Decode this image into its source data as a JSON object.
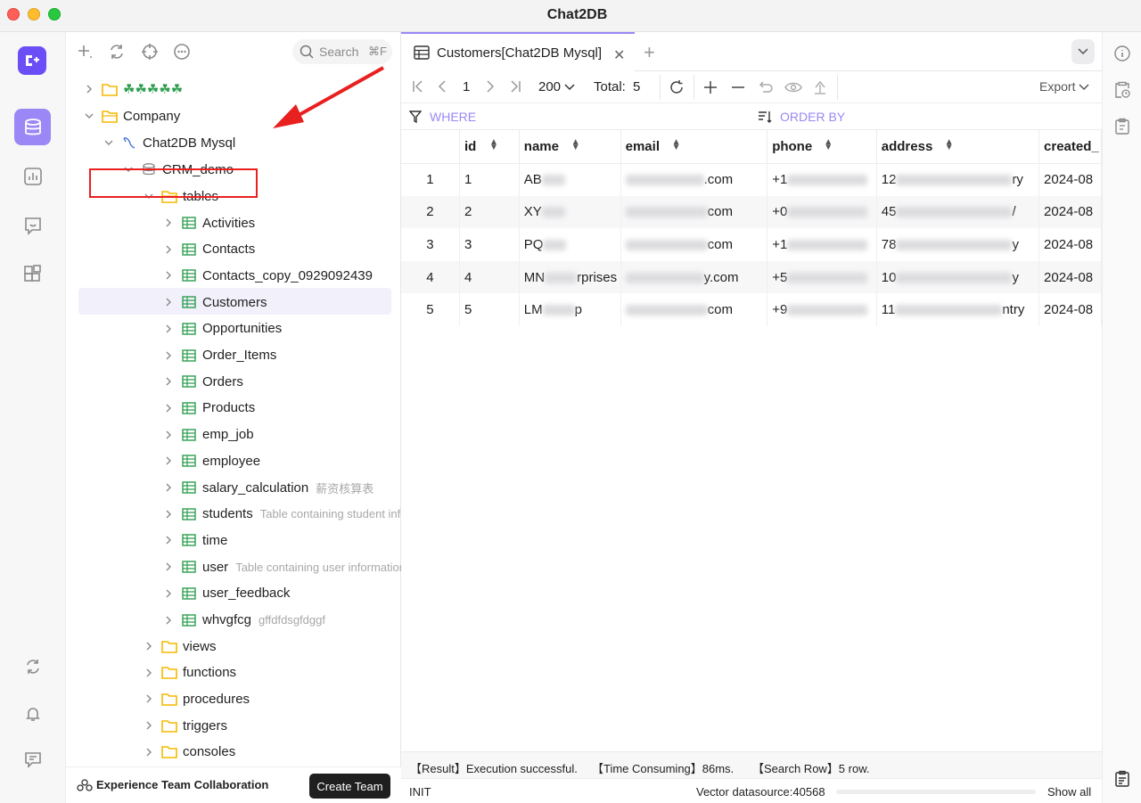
{
  "window": {
    "title": "Chat2DB"
  },
  "activity": {
    "items": [
      {
        "icon": "database-icon",
        "active": true
      },
      {
        "icon": "chart-icon",
        "active": false
      },
      {
        "icon": "chat-icon",
        "active": false
      },
      {
        "icon": "apps-icon",
        "active": false
      }
    ],
    "bottom": [
      "sync-icon",
      "bell-icon",
      "message-icon"
    ]
  },
  "sidebar": {
    "search_placeholder": "Search",
    "search_shortcut": "⌘F",
    "footer_label": "Experience Team Collaboration",
    "create_team_label": "Create Team",
    "tree": {
      "group1": "☘☘☘☘☘",
      "company": "Company",
      "connection": "Chat2DB Mysql",
      "database": "CRM_demo",
      "tables_folder": "tables",
      "tables": [
        {
          "name": "Activities",
          "comment": ""
        },
        {
          "name": "Contacts",
          "comment": ""
        },
        {
          "name": "Contacts_copy_0929092439",
          "comment": ""
        },
        {
          "name": "Customers",
          "comment": ""
        },
        {
          "name": "Opportunities",
          "comment": ""
        },
        {
          "name": "Order_Items",
          "comment": ""
        },
        {
          "name": "Orders",
          "comment": ""
        },
        {
          "name": "Products",
          "comment": ""
        },
        {
          "name": "emp_job",
          "comment": ""
        },
        {
          "name": "employee",
          "comment": ""
        },
        {
          "name": "salary_calculation",
          "comment": "薪资核算表"
        },
        {
          "name": "students",
          "comment": "Table containing student info"
        },
        {
          "name": "time",
          "comment": ""
        },
        {
          "name": "user",
          "comment": "Table containing user information"
        },
        {
          "name": "user_feedback",
          "comment": ""
        },
        {
          "name": "whvgfcg",
          "comment": "gffdfdsgfdggf"
        }
      ],
      "folders": [
        "views",
        "functions",
        "procedures",
        "triggers",
        "consoles"
      ]
    }
  },
  "main": {
    "tab": {
      "label": "Customers[Chat2DB Mysql]"
    },
    "pager": {
      "page": "1",
      "page_size": "200",
      "total_label": "Total:",
      "total": "5",
      "export_label": "Export"
    },
    "filters": {
      "where": "WHERE",
      "order_by": "ORDER BY"
    },
    "grid": {
      "columns": [
        "id",
        "name",
        "email",
        "phone",
        "address",
        "created_"
      ],
      "rows": [
        {
          "rn": "1",
          "id": "1",
          "name_pre": "AB",
          "name_post": "",
          "email_post": ".com",
          "phone_pre": "+1",
          "addr_pre": "12",
          "addr_post": "ry",
          "created": "2024-08"
        },
        {
          "rn": "2",
          "id": "2",
          "name_pre": "XY",
          "name_post": "",
          "email_post": "com",
          "phone_pre": "+0",
          "addr_pre": "45",
          "addr_post": "/",
          "created": "2024-08"
        },
        {
          "rn": "3",
          "id": "3",
          "name_pre": "PQ",
          "name_post": "",
          "email_post": "com",
          "phone_pre": "+1",
          "addr_pre": "78",
          "addr_post": "y",
          "created": "2024-08"
        },
        {
          "rn": "4",
          "id": "4",
          "name_pre": "MN",
          "name_post": "rprises",
          "email_post": "y.com",
          "phone_pre": "+5",
          "addr_pre": "10",
          "addr_post": "y",
          "created": "2024-08"
        },
        {
          "rn": "5",
          "id": "5",
          "name_pre": "LM",
          "name_post": "p",
          "email_post": "com",
          "phone_pre": "+9",
          "addr_pre": "11",
          "addr_post": "ntry",
          "created": "2024-08"
        }
      ]
    },
    "status": {
      "result": "【Result】Execution successful.",
      "time": "【Time Consuming】86ms.",
      "rows": "【Search Row】5 row."
    },
    "bottom": {
      "state": "INIT",
      "vector": "Vector datasource:40568",
      "show_all": "Show all"
    }
  },
  "colors": {
    "accent": "#9b87f5",
    "brand": "#6b4ef6",
    "highlight": "#e8201f",
    "folder": "#f5b800",
    "table": "#2e9e4f"
  }
}
